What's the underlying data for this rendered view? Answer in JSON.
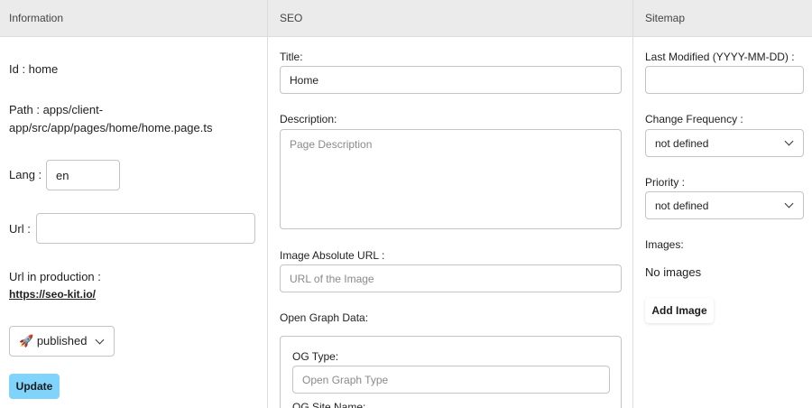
{
  "info": {
    "header": "Information",
    "id_text": "Id : home",
    "path_text_1": "Path : apps/client-",
    "path_text_2": "app/src/app/pages/home/home.page.ts",
    "lang_label": "Lang :",
    "lang_value": "en",
    "url_label": "Url :",
    "url_value": "",
    "url_prod_label": "Url in production :",
    "url_prod_link": "https://seo-kit.io/",
    "status_icon": "🚀",
    "status_value": "published",
    "update_label": "Update"
  },
  "seo": {
    "header": "SEO",
    "title_label": "Title:",
    "title_value": "Home",
    "description_label": "Description:",
    "description_placeholder": "Page Description",
    "image_label": "Image Absolute URL :",
    "image_placeholder": "URL of the Image",
    "og_label": "Open Graph Data:",
    "og_type_label": "OG Type:",
    "og_type_placeholder": "Open Graph Type",
    "og_site_name_label": "OG Site Name:"
  },
  "sitemap": {
    "header": "Sitemap",
    "last_modified_label": "Last Modified (YYYY-MM-DD) :",
    "last_modified_value": "",
    "change_freq_label": "Change Frequency :",
    "change_freq_value": "not defined",
    "priority_label": "Priority :",
    "priority_value": "not defined",
    "images_label": "Images:",
    "no_images_text": "No images",
    "add_image_label": "Add Image"
  },
  "colors": {
    "header_bg": "#ebebeb",
    "update_button": "#80d3fa",
    "border": "#c4c4c4"
  }
}
